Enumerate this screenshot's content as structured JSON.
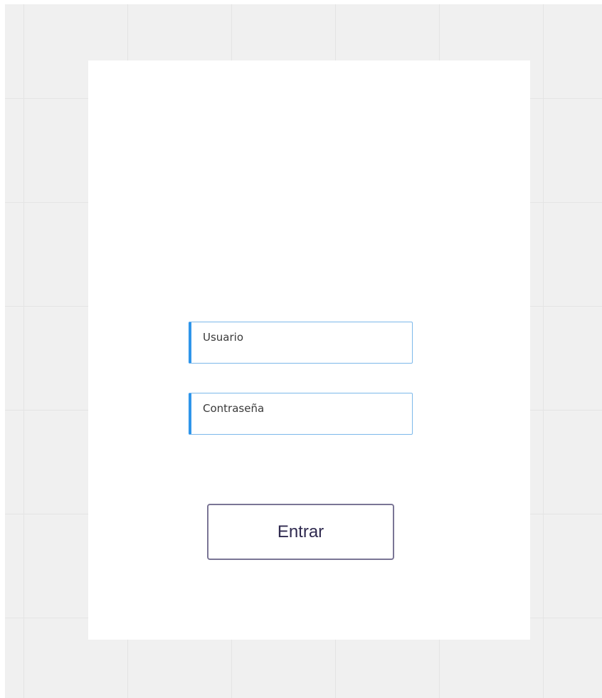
{
  "login": {
    "username_placeholder": "Usuario",
    "password_placeholder": "Contraseña",
    "submit_label": "Entrar"
  },
  "colors": {
    "field_accent": "#2f95ea",
    "field_border": "#7cb8ea",
    "button_border": "#7a7595",
    "button_text": "#2f2a4f",
    "canvas_bg": "#f0f0f0"
  }
}
